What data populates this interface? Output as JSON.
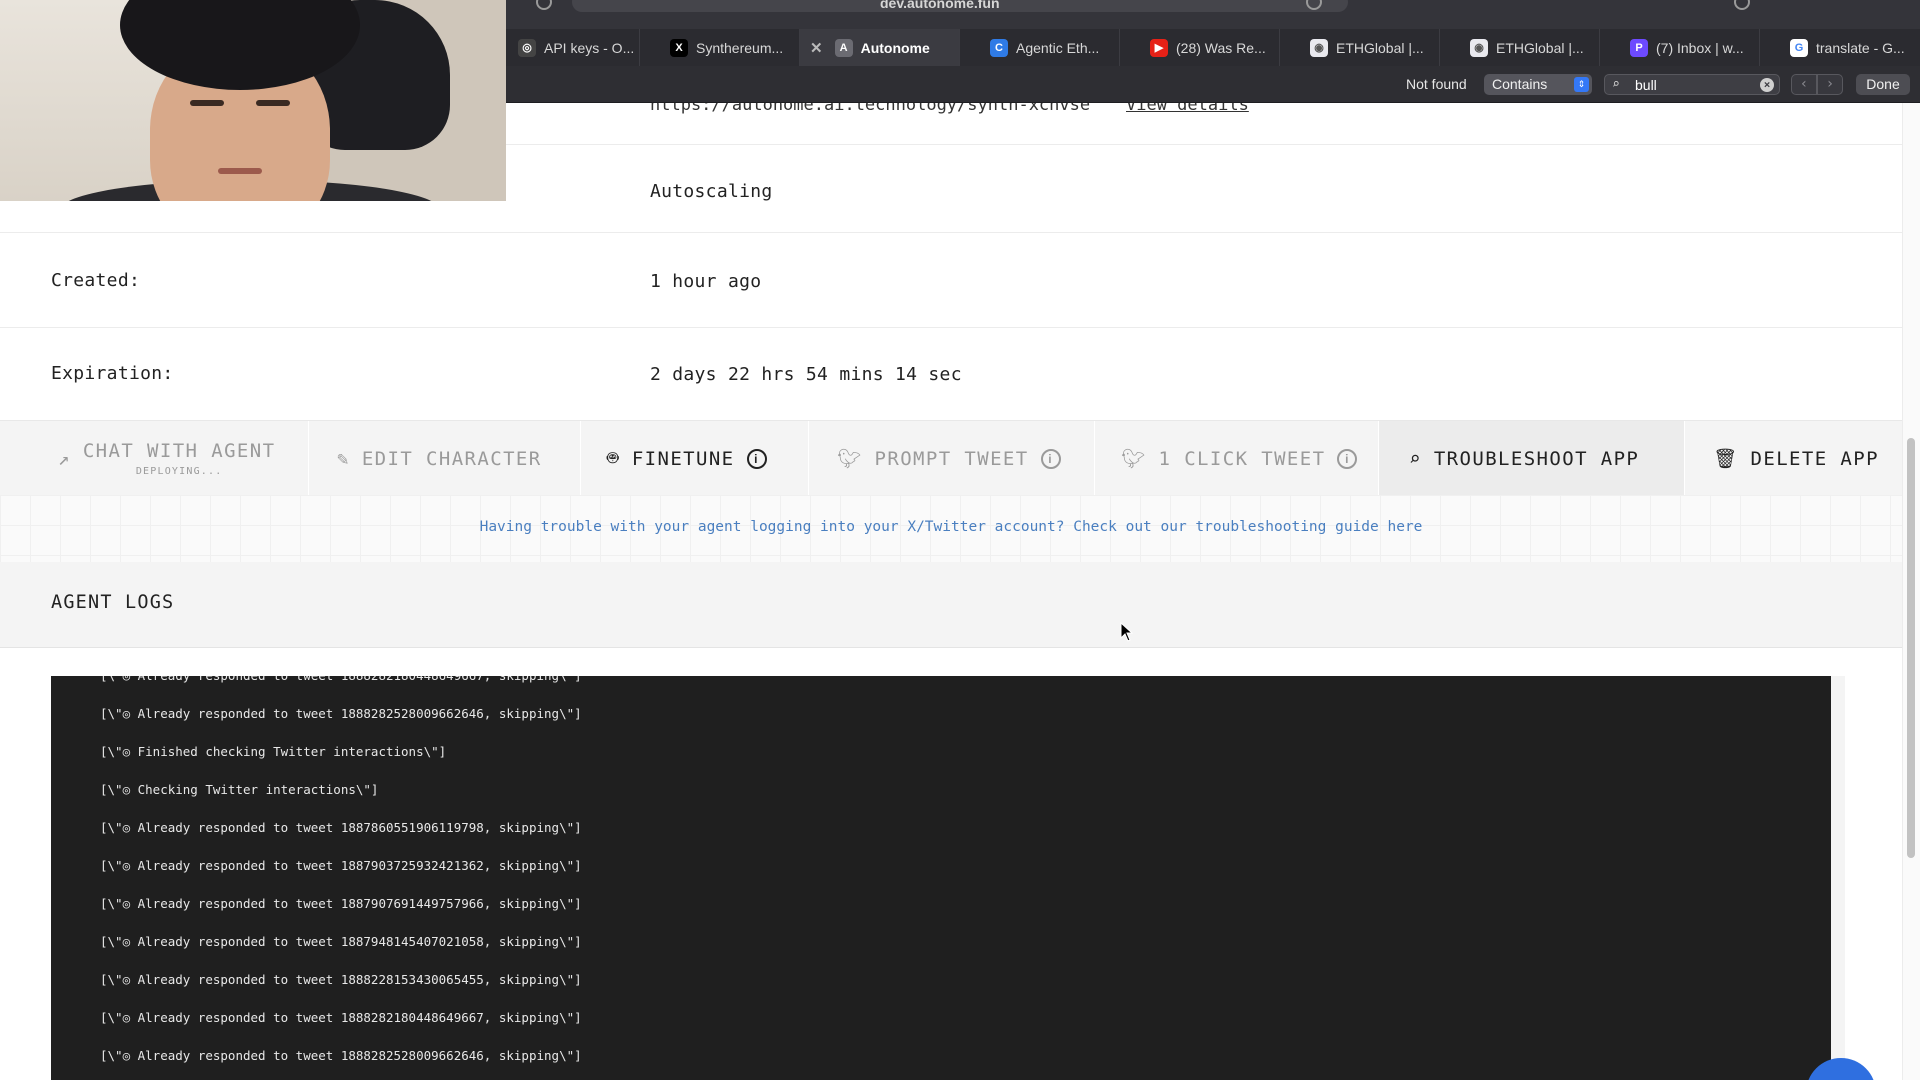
{
  "browser": {
    "address": "dev.autonome.fun",
    "tabs": [
      {
        "label": "API keys - O...",
        "icon": "openai-icon",
        "color": "#444444",
        "glyph": "◎"
      },
      {
        "label": "Synthereum...",
        "icon": "x-logo-icon",
        "color": "#000000",
        "glyph": "X"
      },
      {
        "label": "Autonome",
        "icon": "autonome-icon",
        "color": "#6b6b72",
        "glyph": "A",
        "close": "✕"
      },
      {
        "label": "Agentic Eth...",
        "icon": "agentic-icon",
        "color": "#2f7be6",
        "glyph": "C"
      },
      {
        "label": "(28) Was Re...",
        "icon": "youtube-icon",
        "color": "#e62117",
        "glyph": "▶"
      },
      {
        "label": "ETHGlobal |...",
        "icon": "ethglobal-icon",
        "color": "#e9e9ef",
        "glyph": "◉"
      },
      {
        "label": "ETHGlobal |...",
        "icon": "ethglobal-icon",
        "color": "#e9e9ef",
        "glyph": "◉"
      },
      {
        "label": "(7) Inbox | w...",
        "icon": "proton-icon",
        "color": "#6d4aff",
        "glyph": "P"
      },
      {
        "label": "translate - G...",
        "icon": "google-icon",
        "color": "#ffffff",
        "glyph": "G"
      }
    ]
  },
  "find": {
    "status": "Not found",
    "mode": "Contains",
    "query": "bull",
    "done_label": "Done"
  },
  "details": {
    "url": "https://autonome.ai.technology/synth-xcnvse",
    "view_details": "View details",
    "scaling": "Autoscaling",
    "created_label": "Created:",
    "created_value": "1 hour ago",
    "expiration_label": "Expiration:",
    "expiration_value": "2 days 22 hrs 54 mins 14 sec"
  },
  "actions": {
    "chat": "CHAT WITH AGENT",
    "chat_status": "DEPLOYING...",
    "edit": "EDIT CHARACTER",
    "finetune": "FINETUNE",
    "prompt_tweet": "PROMPT TWEET",
    "one_click_tweet": "1 CLICK TWEET",
    "troubleshoot": "TROUBLESHOOT APP",
    "delete": "DELETE APP"
  },
  "notice": "Having trouble with your agent logging into your X/Twitter account? Check out our troubleshooting guide here",
  "logs": {
    "title": "AGENT LOGS",
    "lines": [
      "[\\\"◎ Already responded to tweet 1888282528009662646, skipping\\\"]",
      "[\\\"◎ Finished checking Twitter interactions\\\"]",
      "[\\\"◎ Checking Twitter interactions\\\"]",
      "[\\\"◎ Already responded to tweet 1887860551906119798, skipping\\\"]",
      "[\\\"◎ Already responded to tweet 1887903725932421362, skipping\\\"]",
      "[\\\"◎ Already responded to tweet 1887907691449757966, skipping\\\"]",
      "[\\\"◎ Already responded to tweet 1887948145407021058, skipping\\\"]",
      "[\\\"◎ Already responded to tweet 1888228153430065455, skipping\\\"]",
      "[\\\"◎ Already responded to tweet 1888282180448649667, skipping\\\"]",
      "[\\\"◎ Already responded to tweet 1888282528009662646, skipping\\\"]"
    ]
  }
}
